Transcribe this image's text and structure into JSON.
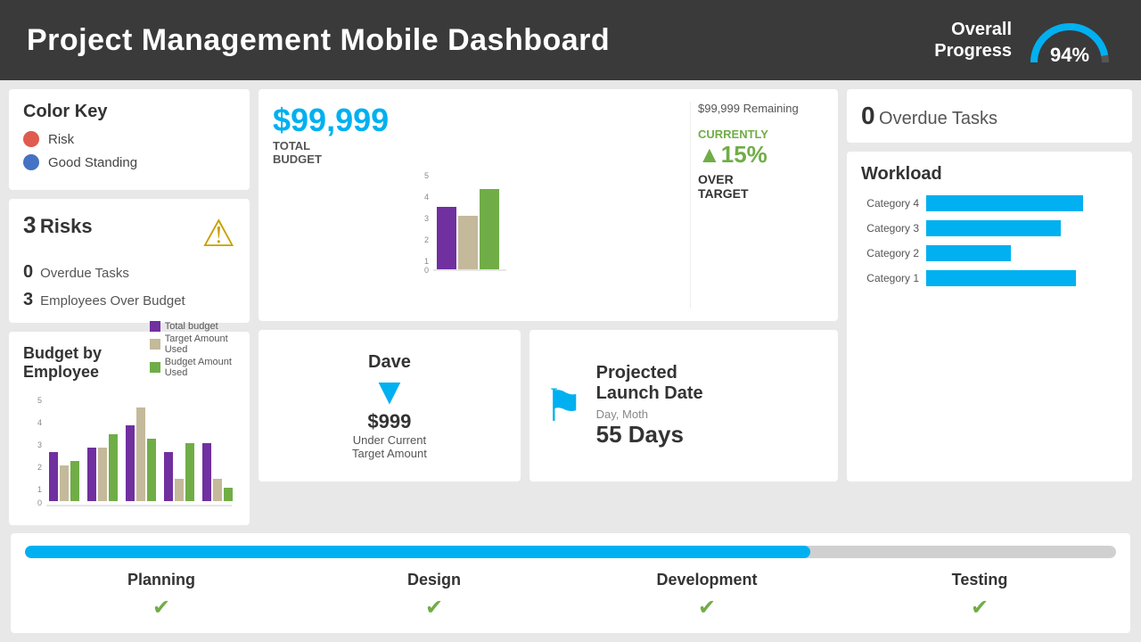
{
  "header": {
    "title": "Project Management Mobile Dashboard",
    "progress_label": "Overall\nProgress",
    "progress_pct": "94%"
  },
  "color_key": {
    "title": "Color Key",
    "items": [
      {
        "label": "Risk",
        "color": "red"
      },
      {
        "label": "Good Standing",
        "color": "blue"
      }
    ]
  },
  "risks": {
    "count": "3",
    "title": "Risks",
    "rows": [
      {
        "num": "0",
        "desc": "Overdue Tasks"
      },
      {
        "num": "3",
        "desc": "Employees Over Budget"
      }
    ]
  },
  "budget_employee": {
    "title": "Budget by Employee",
    "legend": [
      {
        "label": "Total budget",
        "color": "purple"
      },
      {
        "label": "Target Amount Used",
        "color": "tan"
      },
      {
        "label": "Budget Amount Used",
        "color": "green"
      }
    ]
  },
  "budget_overview": {
    "amount": "$99,999",
    "total_label": "TOTAL\nBUDGET",
    "remaining": "$99,999 Remaining",
    "currently_label": "CURRENTLY",
    "pct": "▲15%",
    "over_target": "OVER\nTARGET"
  },
  "dave": {
    "name": "Dave",
    "amount": "$999",
    "desc": "Under Current\nTarget Amount"
  },
  "launch": {
    "title": "Projected\nLaunch Date",
    "date_label": "Day, Moth",
    "days": "55 Days"
  },
  "overdue": {
    "num": "0",
    "label": "Overdue Tasks"
  },
  "workload": {
    "title": "Workload",
    "categories": [
      {
        "label": "Category 4",
        "pct": 82
      },
      {
        "label": "Category 3",
        "pct": 70
      },
      {
        "label": "Category 2",
        "pct": 44
      },
      {
        "label": "Category 1",
        "pct": 78
      }
    ]
  },
  "phases": [
    {
      "name": "Planning",
      "done": true
    },
    {
      "name": "Design",
      "done": true
    },
    {
      "name": "Development",
      "done": true
    },
    {
      "name": "Testing",
      "done": true
    }
  ],
  "progress_bar_pct": 72
}
